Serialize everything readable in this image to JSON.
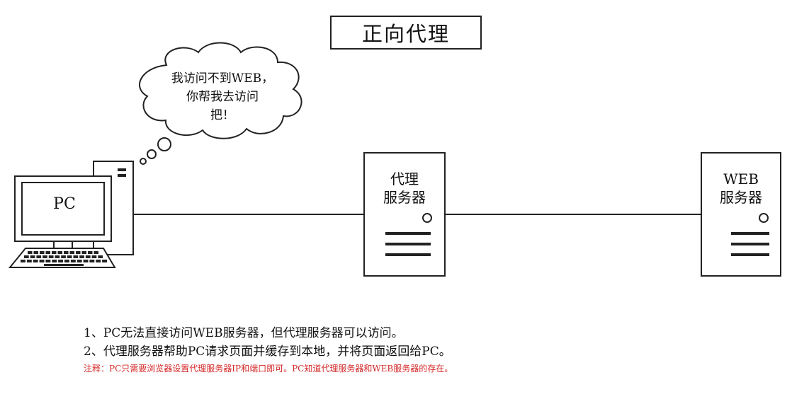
{
  "title": "正向代理",
  "cloud_bubble": {
    "lines": [
      "我访问不到WEB，",
      "你帮我去访问",
      "把！"
    ]
  },
  "pc": {
    "label": "PC"
  },
  "proxy_server": {
    "lines": [
      "代理",
      "服务器"
    ]
  },
  "web_server": {
    "lines": [
      "WEB",
      "服务器"
    ]
  },
  "notes": {
    "line1": "1、PC无法直接访问WEB服务器，但代理服务器可以访问。",
    "line2": "2、代理服务器帮助PC请求页面并缓存到本地，并将页面返回给PC。",
    "remark": "注释：PC只需要浏览器设置代理服务器IP和端口即可。PC知道代理服务器和WEB服务器的存在。"
  },
  "colors": {
    "remark": "#d42a2a",
    "stroke": "#222222"
  }
}
